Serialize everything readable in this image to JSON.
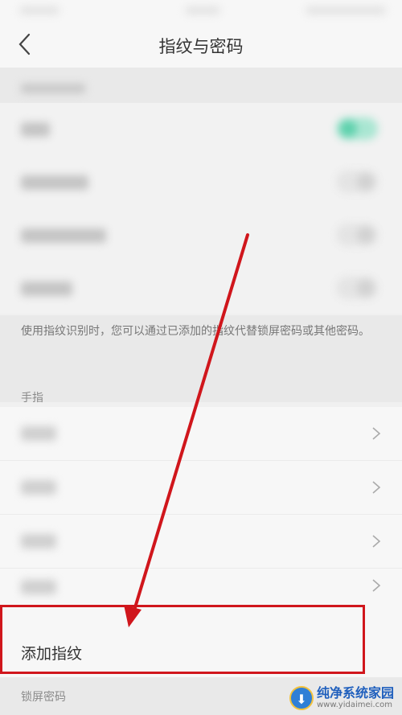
{
  "header": {
    "title": "指纹与密码"
  },
  "settings_rows": [
    {
      "toggle": "on"
    },
    {
      "toggle": "off"
    },
    {
      "toggle": "off"
    },
    {
      "toggle": "off"
    }
  ],
  "description": "使用指纹识别时，您可以通过已添加的指纹代替锁屏密码或其他密码。",
  "fingers_section": {
    "label": "手指",
    "rows_count": 4,
    "add_label": "添加指纹"
  },
  "lock_section": {
    "label": "锁屏密码"
  },
  "colors": {
    "accent_toggle": "#5fd1ad",
    "annotation_red": "#d0161c"
  },
  "watermark": {
    "title": "纯净系统家园",
    "url": "www.yidaimei.com"
  }
}
